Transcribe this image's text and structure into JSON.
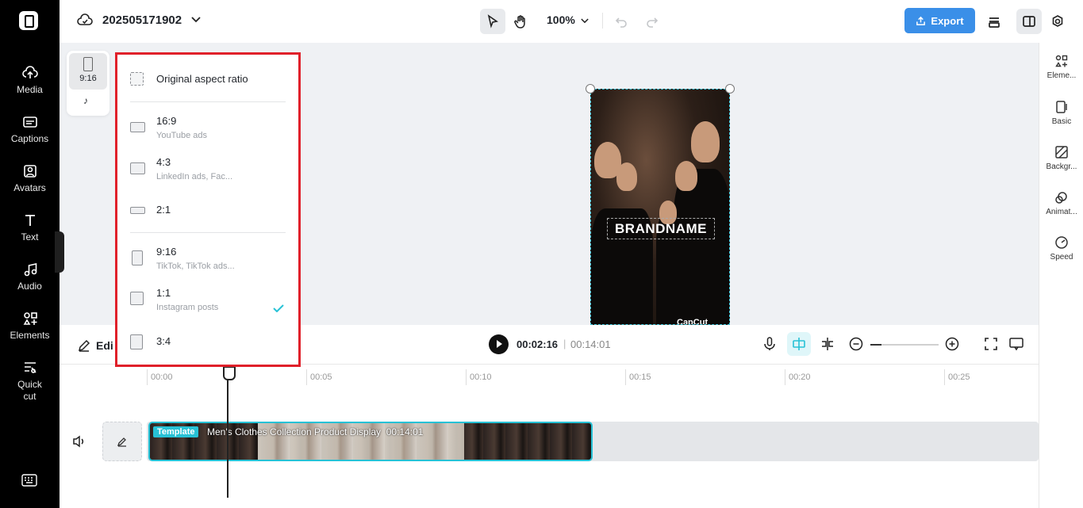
{
  "sidebar": {
    "items": [
      {
        "label": "Media",
        "icon": "cloud-upload-icon"
      },
      {
        "label": "Captions",
        "icon": "captions-icon"
      },
      {
        "label": "Avatars",
        "icon": "avatar-icon"
      },
      {
        "label": "Text",
        "icon": "text-icon"
      },
      {
        "label": "Audio",
        "icon": "music-icon"
      },
      {
        "label": "Elements",
        "icon": "elements-icon"
      },
      {
        "label": "Quick cut",
        "icon": "quick-cut-icon"
      }
    ]
  },
  "header": {
    "project_name": "202505171902",
    "zoom": "100%",
    "export_label": "Export"
  },
  "right_panel": {
    "items": [
      {
        "label": "Eleme..."
      },
      {
        "label": "Basic"
      },
      {
        "label": "Backgr..."
      },
      {
        "label": "Animat..."
      },
      {
        "label": "Speed"
      }
    ]
  },
  "ratio_mini": {
    "selected": "9:16"
  },
  "ratio_dropdown": {
    "original": "Original aspect ratio",
    "options": [
      {
        "label": "16:9",
        "sub": "YouTube ads"
      },
      {
        "label": "4:3",
        "sub": "LinkedIn ads, Fac..."
      },
      {
        "label": "2:1",
        "sub": ""
      },
      {
        "label": "9:16",
        "sub": "TikTok, TikTok ads..."
      },
      {
        "label": "1:1",
        "sub": "Instagram posts"
      },
      {
        "label": "3:4",
        "sub": ""
      }
    ],
    "selected": "9:16"
  },
  "preview": {
    "brand_text": "BRANDNAME",
    "watermark": "CapCut"
  },
  "timeline": {
    "edit_label": "Edi",
    "current_time": "00:02:16",
    "total_time": "00:14:01",
    "ruler": [
      "00:00",
      "00:05",
      "00:10",
      "00:15",
      "00:20",
      "00:25"
    ],
    "clip": {
      "tag": "Template",
      "title": "Men's Clothes Collection Product Display",
      "duration": "00:14:01"
    }
  },
  "colors": {
    "accent": "#27c2d6",
    "export": "#3a8fe8",
    "highlight": "#e0202a"
  }
}
